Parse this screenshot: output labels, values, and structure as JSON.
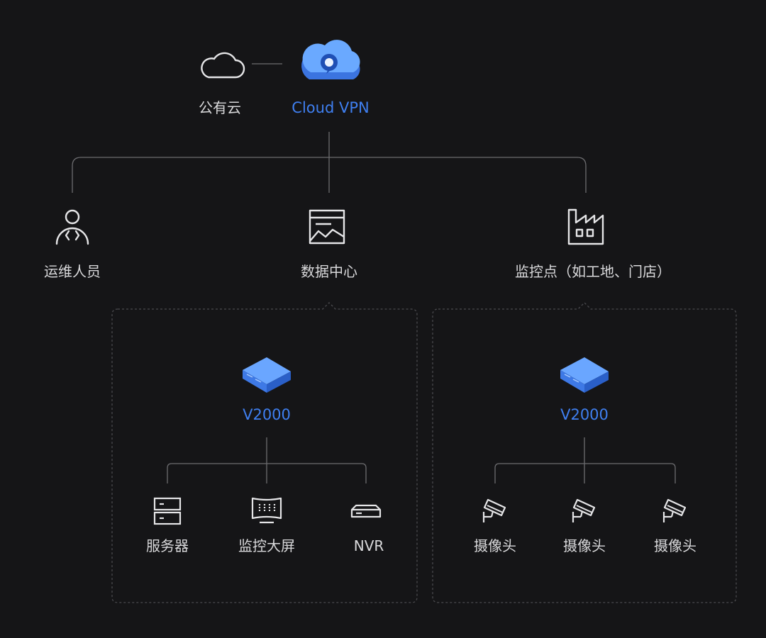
{
  "colors": {
    "background": "#151517",
    "line": "#6d6d70",
    "text": "#d9d9db",
    "accent": "#3f7ff0",
    "group_border": "#4a4a4e"
  },
  "top": {
    "public_cloud": {
      "icon": "cloud-outline-icon",
      "label": "公有云"
    },
    "cloud_vpn": {
      "icon": "cloud-vpn-icon",
      "label": "Cloud VPN"
    }
  },
  "nodes": {
    "ops": {
      "icon": "engineer-icon",
      "label": "运维人员"
    },
    "datacenter": {
      "icon": "dashboard-chart-icon",
      "label": "数据中心"
    },
    "site": {
      "icon": "factory-icon",
      "label": "监控点（如工地、门店）"
    }
  },
  "groups": {
    "datacenter_group": {
      "device": {
        "icon": "gateway-device-icon",
        "label": "V2000"
      },
      "children": [
        {
          "icon": "server-icon",
          "label": "服务器"
        },
        {
          "icon": "video-wall-icon",
          "label": "监控大屏"
        },
        {
          "icon": "nvr-icon",
          "label": "NVR"
        }
      ]
    },
    "site_group": {
      "device": {
        "icon": "gateway-device-icon",
        "label": "V2000"
      },
      "children": [
        {
          "icon": "camera-icon",
          "label": "摄像头"
        },
        {
          "icon": "camera-icon",
          "label": "摄像头"
        },
        {
          "icon": "camera-icon",
          "label": "摄像头"
        }
      ]
    }
  }
}
